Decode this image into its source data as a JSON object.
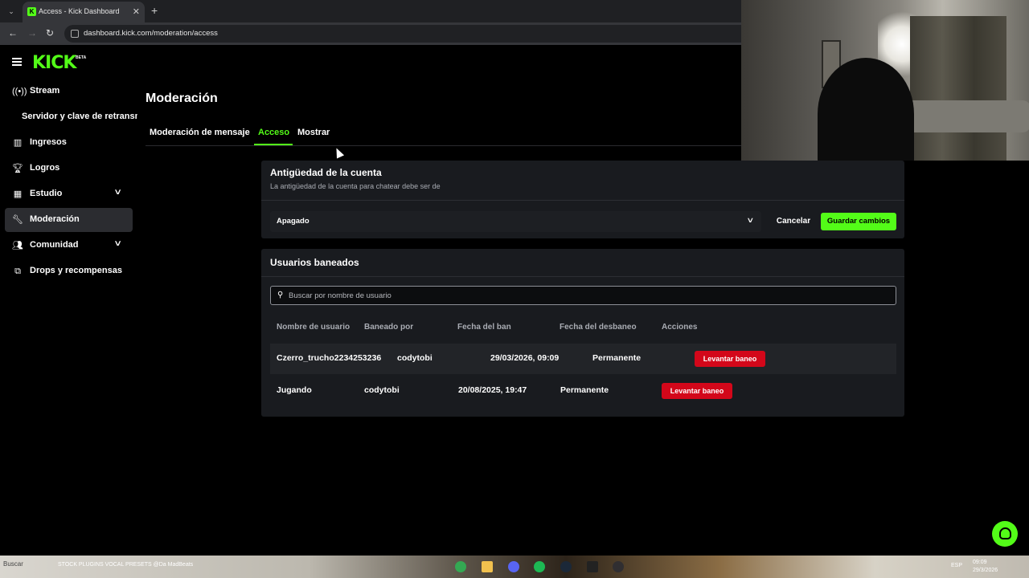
{
  "browser": {
    "tab_title": "Access - Kick Dashboard",
    "tab_favicon": "K",
    "tab_close": "✕",
    "new_tab": "+",
    "url": "dashboard.kick.com/moderation/access"
  },
  "brand": {
    "logo": "KICK",
    "badge": "BETA",
    "accent_color": "#53fc18"
  },
  "sidebar": {
    "items": [
      {
        "label": "Stream",
        "icon": "broadcast-icon"
      },
      {
        "label": "Servidor y clave de retransmisión"
      },
      {
        "label": "Ingresos",
        "icon": "chart-icon"
      },
      {
        "label": "Logros",
        "icon": "trophy-icon"
      },
      {
        "label": "Estudio",
        "icon": "grid-icon",
        "expandable": true
      },
      {
        "label": "Moderación",
        "icon": "wrench-icon",
        "active": true
      },
      {
        "label": "Comunidad",
        "icon": "users-icon",
        "expandable": true
      },
      {
        "label": "Drops y recompensas",
        "icon": "drops-icon"
      }
    ]
  },
  "page": {
    "title": "Moderación",
    "tabs": [
      {
        "label": "Moderación de mensaje"
      },
      {
        "label": "Acceso",
        "active": true
      },
      {
        "label": "Mostrar"
      }
    ]
  },
  "account_age": {
    "title": "Antigüedad de la cuenta",
    "description": "La antigüedad de la cuenta para chatear debe ser de",
    "selected_value": "Apagado",
    "cancel_label": "Cancelar",
    "save_label": "Guardar cambios"
  },
  "banned_users": {
    "title": "Usuarios baneados",
    "search_placeholder": "Buscar por nombre de usuario",
    "columns": [
      "Nombre de usuario",
      "Baneado por",
      "Fecha del ban",
      "Fecha del desbaneo",
      "Acciones"
    ],
    "rows": [
      {
        "username": "Czerro_trucho2234253236",
        "banned_by": "codytobi",
        "ban_date": "29/03/2026, 09:09",
        "unban_date": "Permanente",
        "action": "Levantar baneo"
      },
      {
        "username": "Jugando",
        "banned_by": "codytobi",
        "ban_date": "20/08/2025, 19:47",
        "unban_date": "Permanente",
        "action": "Levantar baneo"
      }
    ],
    "action_color": "#d3071a"
  },
  "taskbar": {
    "search_label": "Buscar",
    "pinned_label": "STOCK PLUGINS VOCAL PRESETS @Da MadBeats",
    "language": "ESP",
    "time": "09:09",
    "date": "29/3/2026"
  }
}
